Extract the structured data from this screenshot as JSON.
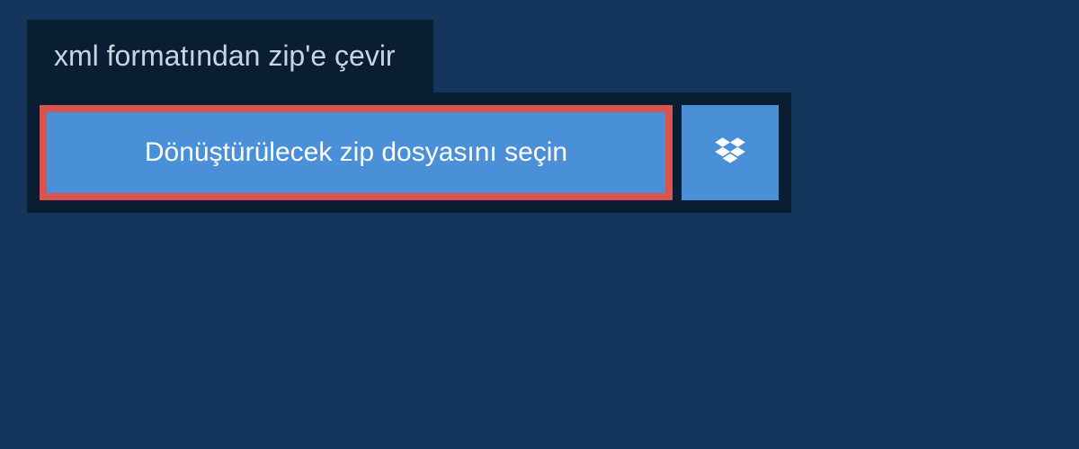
{
  "header": {
    "title": "xml formatından zip'e çevir"
  },
  "upload": {
    "select_file_label": "Dönüştürülecek zip dosyasını seçin"
  },
  "colors": {
    "background": "#14365c",
    "panel": "#0a1e33",
    "button": "#4a90d9",
    "button_highlight_border": "#d9534f",
    "text_light": "#ffffff",
    "text_muted": "#c8d4e0"
  }
}
